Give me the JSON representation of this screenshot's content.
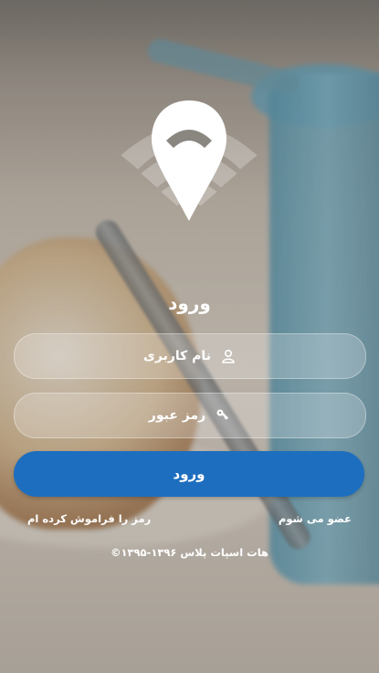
{
  "login": {
    "title": "ورود",
    "username_placeholder": "نام کاربری",
    "password_placeholder": "رمز عبور",
    "submit_label": "ورود",
    "register_link": "عضو می شوم",
    "forgot_link": "رمز را فراموش کرده ام"
  },
  "footer": {
    "copyright": "©۱۳۹۵-۱۳۹۶ هات اسپات پلاس"
  },
  "icons": {
    "logo": "location-pin-wifi-icon",
    "username": "user-icon",
    "password": "key-icon"
  },
  "colors": {
    "primary_button": "#1d6ebf",
    "text": "#ffffff"
  }
}
